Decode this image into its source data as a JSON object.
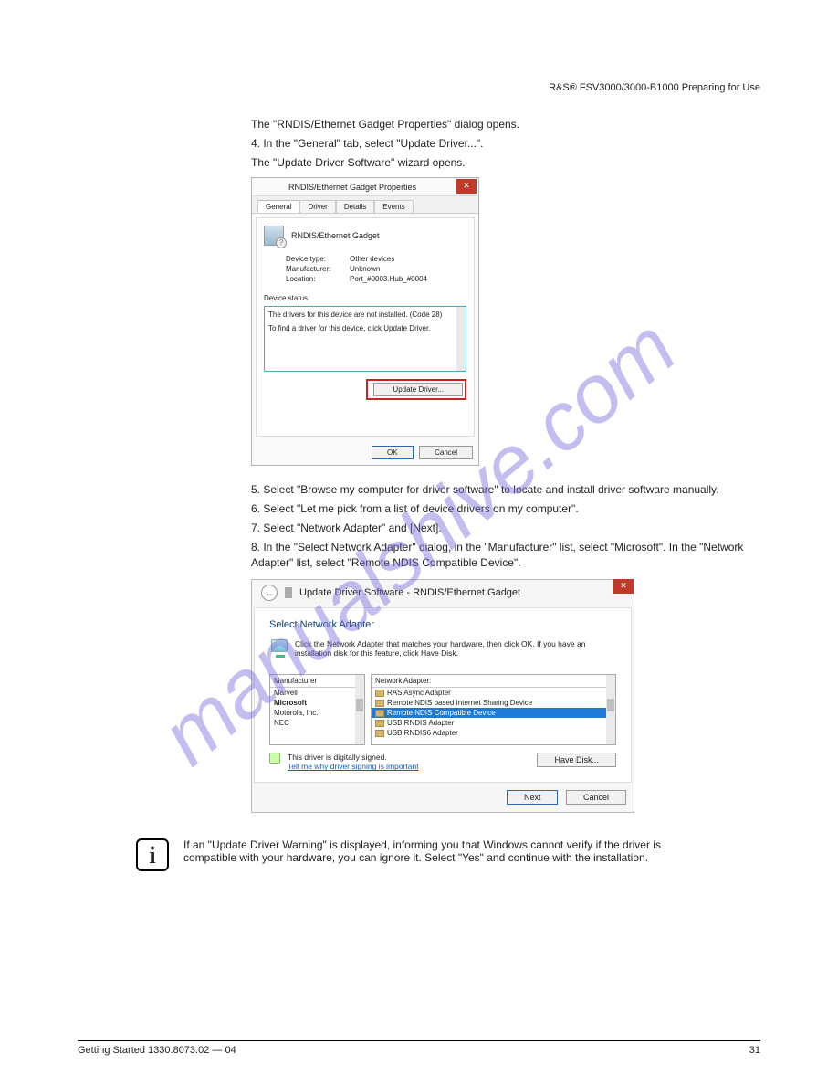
{
  "doc": {
    "header": "R&S® FSV3000/3000-B1000  Preparing for Use",
    "intro_line": "The \"RNDIS/Ethernet Gadget Properties\" dialog opens.",
    "step4_a": "4. In the \"General\" tab, select \"Update Driver...\".",
    "step4_b": "The \"Update Driver Software\" wizard opens.",
    "step5": "5. Select \"Browse my computer for driver software\" to locate and install driver software manually.",
    "step6": "6. Select \"Let me pick from a list of device drivers on my computer\".",
    "step7": "7. Select \"Network Adapter\" and [Next].",
    "step8": "8. In the \"Select Network Adapter\" dialog, in the \"Manufacturer\" list, select \"Microsoft\". In the \"Network Adapter\" list, select \"Remote NDIS Compatible Device\".",
    "info_text": "If an \"Update Driver Warning\" is displayed, informing you that Windows cannot verify if the driver is compatible with your hardware, you can ignore it. Select \"Yes\" and continue with the installation.",
    "footer_left": "Getting Started 1330.8073.02 — 04",
    "footer_right": "31"
  },
  "dlg1": {
    "title": "RNDIS/Ethernet Gadget Properties",
    "tabs": [
      "General",
      "Driver",
      "Details",
      "Events"
    ],
    "device_name": "RNDIS/Ethernet Gadget",
    "kv": {
      "type_label": "Device type:",
      "type_val": "Other devices",
      "mfr_label": "Manufacturer:",
      "mfr_val": "Unknown",
      "loc_label": "Location:",
      "loc_val": "Port_#0003.Hub_#0004"
    },
    "status_label": "Device status",
    "status_line1": "The drivers for this device are not installed. (Code 28)",
    "status_line2": "To find a driver for this device, click Update Driver.",
    "update_btn": "Update Driver...",
    "ok": "OK",
    "cancel": "Cancel"
  },
  "wiz": {
    "header": "Update Driver Software - RNDIS/Ethernet Gadget",
    "title": "Select Network Adapter",
    "desc": "Click the Network Adapter that matches your hardware, then click OK. If you have an installation disk for this feature, click Have Disk.",
    "left_hdr": "Manufacturer",
    "left_items": [
      "Marvell",
      "Microsoft",
      "Motorola, Inc.",
      "NEC"
    ],
    "left_selected": "Microsoft",
    "right_hdr": "Network Adapter:",
    "right_items": [
      "RAS Async Adapter",
      "Remote NDIS based Internet Sharing Device",
      "Remote NDIS Compatible Device",
      "USB RNDIS Adapter",
      "USB RNDIS6 Adapter"
    ],
    "right_selected": "Remote NDIS Compatible Device",
    "signed": "This driver is digitally signed.",
    "signed_link": "Tell me why driver signing is important",
    "have_disk": "Have Disk...",
    "next": "Next",
    "cancel": "Cancel"
  }
}
